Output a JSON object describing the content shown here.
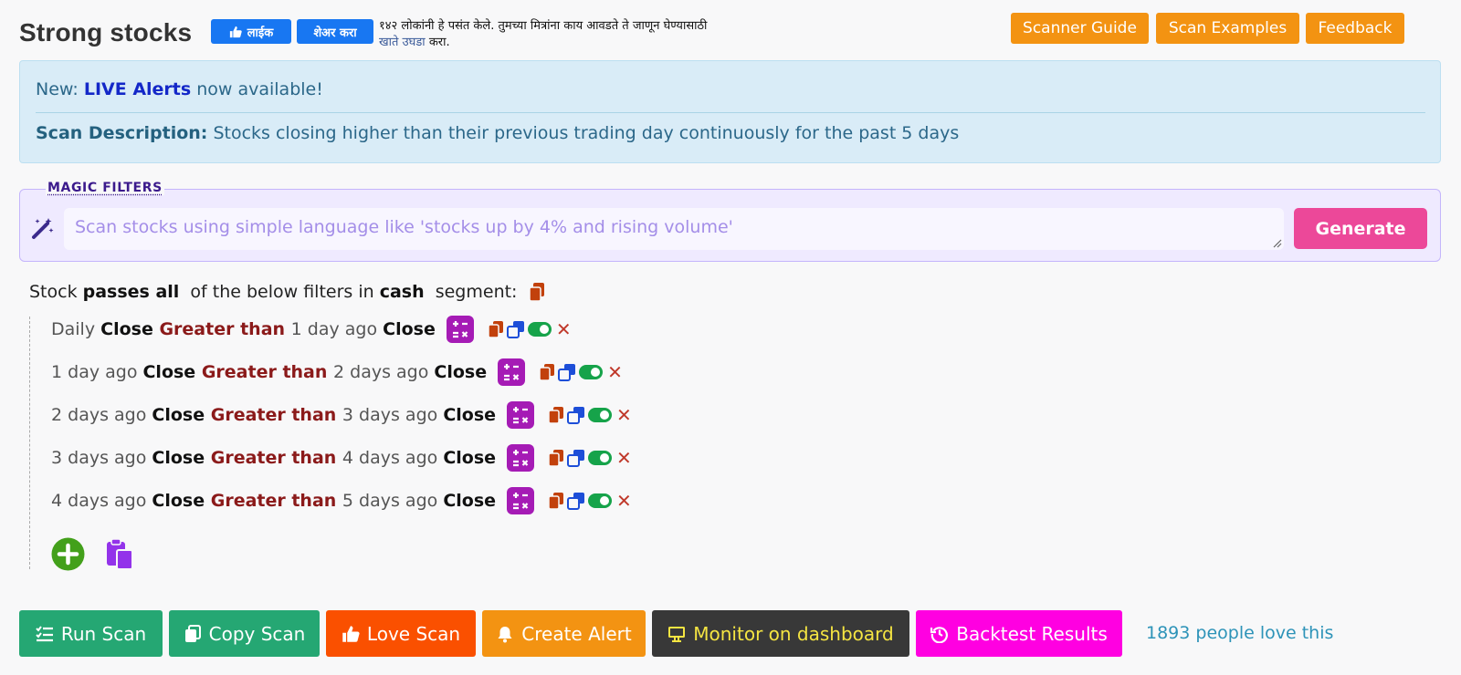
{
  "header": {
    "title": "Strong stocks",
    "fb_like_label": "लाईक",
    "fb_share_label": "शेअर करा",
    "fb_text_line1": "१४२ लोकांनी हे पसंत केले. तुमच्या मित्रांना काय आवडते ते जाणून घेण्यासाठी",
    "fb_text_link": "खाते उघडा",
    "fb_text_end": " करा."
  },
  "alert": {
    "news_prefix": "New: ",
    "news_highlight": "LIVE Alerts",
    "news_suffix": " now available!",
    "buttons": {
      "guide": "Scanner Guide",
      "examples": "Scan Examples",
      "feedback": "Feedback"
    },
    "desc_label": "Scan Description:",
    "desc_text": " Stocks closing higher than their previous trading day continuously for the past 5 days"
  },
  "magic": {
    "label": "MAGIC FILTERS",
    "placeholder": "Scan stocks using simple language like 'stocks up by 4% and rising volume'",
    "generate_label": "Generate"
  },
  "summary": {
    "p1": "Stock ",
    "p2": "passes all",
    "p3": "  of the below filters in ",
    "p4": "cash",
    "p5": "  segment:"
  },
  "filters": [
    {
      "lhs_period": "Daily ",
      "lhs_field": "Close",
      "op": " Greater than ",
      "rhs_period": "1 day ago ",
      "rhs_field": "Close"
    },
    {
      "lhs_period": "1 day ago ",
      "lhs_field": "Close",
      "op": " Greater than ",
      "rhs_period": "2 days ago ",
      "rhs_field": "Close"
    },
    {
      "lhs_period": "2 days ago ",
      "lhs_field": "Close",
      "op": " Greater than ",
      "rhs_period": "3 days ago ",
      "rhs_field": "Close"
    },
    {
      "lhs_period": "3 days ago ",
      "lhs_field": "Close",
      "op": " Greater than ",
      "rhs_period": "4 days ago ",
      "rhs_field": "Close"
    },
    {
      "lhs_period": "4 days ago ",
      "lhs_field": "Close",
      "op": " Greater than ",
      "rhs_period": "5 days ago ",
      "rhs_field": "Close"
    }
  ],
  "remove_glyph": "✕",
  "actions": {
    "run": "Run Scan",
    "copy": "Copy Scan",
    "love": "Love Scan",
    "alert": "Create Alert",
    "monitor": "Monitor on dashboard",
    "backtest": "Backtest Results"
  },
  "love_count_text": "1893 people love this",
  "colors": {
    "primary_green": "#25a773",
    "orange": "#f39312",
    "love_red": "#fa5000",
    "magenta": "#ff00e1",
    "generate_pink": "#ec4899",
    "operator_red": "#8b1a1a",
    "calc_purple": "#a51bb5"
  }
}
